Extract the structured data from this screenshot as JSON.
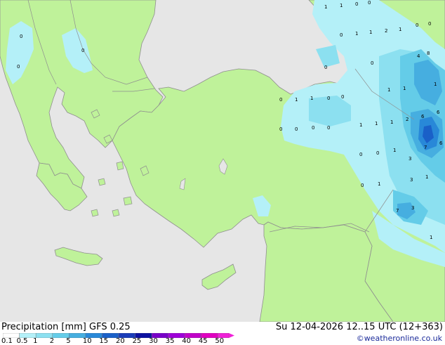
{
  "footer": {
    "product": "Precipitation [mm]",
    "model": "GFS 0.25",
    "valid_time": "Su 12-04-2026 12..15 UTC (12+363)",
    "credit": "©weatheronline.co.uk"
  },
  "legend": {
    "tick_labels": [
      "0.1",
      "0.5",
      "1",
      "2",
      "5",
      "10",
      "15",
      "20",
      "25",
      "30",
      "35",
      "40",
      "45",
      "50"
    ],
    "colors": [
      "#ffffff",
      "#b4f0f8",
      "#8ce0f0",
      "#64cce8",
      "#46aee0",
      "#2888d8",
      "#1a60c8",
      "#1a3cb8",
      "#0c10a0",
      "#7800c8",
      "#9e00d8",
      "#c000c8",
      "#e000c0",
      "#f020d8"
    ]
  },
  "map_colors": {
    "sea": "#e6e6e6",
    "land": "#bff29a",
    "coast": "#8f8f8f",
    "precip_light": "#b4f0f8",
    "precip_mid": "#64cce8",
    "precip_heavy": "#2888d8",
    "precip_max": "#1a3cb8"
  },
  "precip_labels": [
    {
      "text": "1"
    },
    {
      "text": "1"
    },
    {
      "text": "0"
    },
    {
      "text": "0"
    },
    {
      "text": "0"
    },
    {
      "text": "1"
    },
    {
      "text": "1"
    },
    {
      "text": "2"
    },
    {
      "text": "1"
    },
    {
      "text": "0"
    },
    {
      "text": "0"
    },
    {
      "text": "0"
    },
    {
      "text": "4"
    },
    {
      "text": "8"
    },
    {
      "text": "0"
    },
    {
      "text": "0"
    },
    {
      "text": "1"
    },
    {
      "text": "1"
    },
    {
      "text": "0"
    },
    {
      "text": "0"
    },
    {
      "text": "1"
    },
    {
      "text": "1"
    },
    {
      "text": "1"
    },
    {
      "text": "0"
    },
    {
      "text": "0"
    },
    {
      "text": "0"
    },
    {
      "text": "0"
    },
    {
      "text": "1"
    },
    {
      "text": "1"
    },
    {
      "text": "1"
    },
    {
      "text": "2"
    },
    {
      "text": "6"
    },
    {
      "text": "6"
    },
    {
      "text": "0"
    },
    {
      "text": "0"
    },
    {
      "text": "1"
    },
    {
      "text": "3"
    },
    {
      "text": "7"
    },
    {
      "text": "6"
    },
    {
      "text": "0"
    },
    {
      "text": "1"
    },
    {
      "text": "3"
    },
    {
      "text": "1"
    },
    {
      "text": "7"
    },
    {
      "text": "3"
    },
    {
      "text": "1"
    },
    {
      "text": "0"
    },
    {
      "text": "0"
    },
    {
      "text": "0"
    }
  ]
}
